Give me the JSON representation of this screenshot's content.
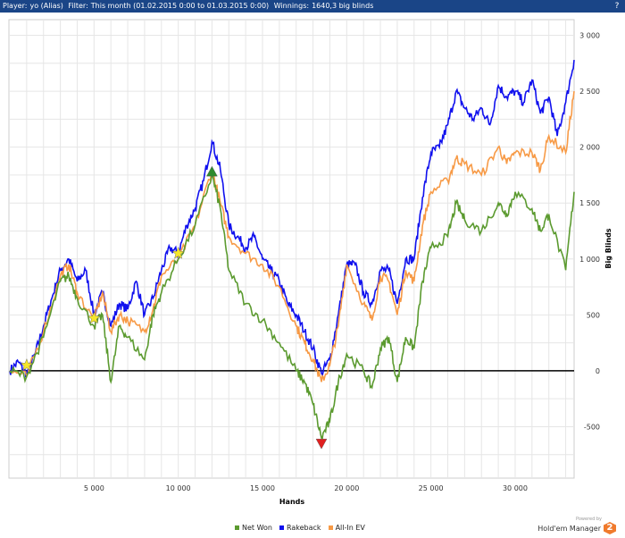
{
  "header": {
    "player_label": "Player:",
    "player": "yo (Alias)",
    "filter_label": "Filter:",
    "filter": "This month (01.02.2015 0:00 to 01.03.2015 0:00)",
    "winnings_label": "Winnings:",
    "winnings": "1640,3 big blinds",
    "help_icon": "?"
  },
  "branding": {
    "powered_by": "Powered by",
    "product": "Hold'em Manager",
    "logo_text": "2"
  },
  "chart_data": {
    "type": "line",
    "xlabel": "Hands",
    "ylabel": "Big Blinds",
    "xlim": [
      0,
      33500
    ],
    "ylim": [
      -960,
      3140
    ],
    "xticks": [
      5000,
      10000,
      15000,
      20000,
      25000,
      30000
    ],
    "xtick_labels": [
      "5 000",
      "10 000",
      "15 000",
      "20 000",
      "25 000",
      "30 000"
    ],
    "yticks": [
      -500,
      0,
      500,
      1000,
      1500,
      2000,
      2500,
      3000
    ],
    "ytick_labels": [
      "-500",
      "0",
      "500",
      "1 000",
      "1 500",
      "2 000",
      "2 500",
      "3 000"
    ],
    "grid": true,
    "legend_position": "bottom",
    "series": [
      {
        "name": "Net Won",
        "color": "#5b9a2f",
        "points": [
          [
            0,
            0
          ],
          [
            1000,
            -50
          ],
          [
            2000,
            300
          ],
          [
            3000,
            800
          ],
          [
            3500,
            850
          ],
          [
            4000,
            650
          ],
          [
            5000,
            400
          ],
          [
            5500,
            500
          ],
          [
            6000,
            -100
          ],
          [
            6500,
            400
          ],
          [
            7000,
            300
          ],
          [
            8000,
            100
          ],
          [
            8500,
            500
          ],
          [
            9000,
            700
          ],
          [
            10000,
            1000
          ],
          [
            11000,
            1300
          ],
          [
            12000,
            1750
          ],
          [
            12500,
            1450
          ],
          [
            13000,
            900
          ],
          [
            14000,
            600
          ],
          [
            15000,
            450
          ],
          [
            16000,
            250
          ],
          [
            17000,
            0
          ],
          [
            17500,
            -100
          ],
          [
            18000,
            -300
          ],
          [
            18500,
            -600
          ],
          [
            19000,
            -450
          ],
          [
            19500,
            -100
          ],
          [
            20000,
            150
          ],
          [
            21000,
            0
          ],
          [
            21500,
            -150
          ],
          [
            22000,
            200
          ],
          [
            22500,
            300
          ],
          [
            23000,
            -100
          ],
          [
            23500,
            300
          ],
          [
            24000,
            200
          ],
          [
            24500,
            800
          ],
          [
            25000,
            1100
          ],
          [
            26000,
            1200
          ],
          [
            26500,
            1500
          ],
          [
            27000,
            1350
          ],
          [
            28000,
            1250
          ],
          [
            29000,
            1500
          ],
          [
            29500,
            1400
          ],
          [
            30000,
            1600
          ],
          [
            31000,
            1450
          ],
          [
            31500,
            1250
          ],
          [
            32000,
            1400
          ],
          [
            33000,
            900
          ],
          [
            33500,
            1600
          ]
        ]
      },
      {
        "name": "Rakeback",
        "color": "#1010ee",
        "points": [
          [
            0,
            0
          ],
          [
            500,
            80
          ],
          [
            1000,
            -30
          ],
          [
            1500,
            150
          ],
          [
            2000,
            400
          ],
          [
            2500,
            650
          ],
          [
            3000,
            900
          ],
          [
            3500,
            1000
          ],
          [
            4000,
            800
          ],
          [
            4500,
            900
          ],
          [
            5000,
            500
          ],
          [
            5500,
            700
          ],
          [
            6000,
            400
          ],
          [
            6500,
            600
          ],
          [
            7000,
            550
          ],
          [
            7500,
            800
          ],
          [
            8000,
            500
          ],
          [
            8500,
            650
          ],
          [
            9000,
            900
          ],
          [
            9500,
            1100
          ],
          [
            10000,
            1050
          ],
          [
            10500,
            1300
          ],
          [
            11000,
            1450
          ],
          [
            11500,
            1700
          ],
          [
            12000,
            2050
          ],
          [
            12500,
            1800
          ],
          [
            13000,
            1300
          ],
          [
            13500,
            1200
          ],
          [
            14000,
            1100
          ],
          [
            14500,
            1200
          ],
          [
            15000,
            1000
          ],
          [
            15500,
            900
          ],
          [
            16000,
            800
          ],
          [
            16500,
            600
          ],
          [
            17000,
            500
          ],
          [
            17500,
            350
          ],
          [
            18000,
            200
          ],
          [
            18500,
            -20
          ],
          [
            19000,
            100
          ],
          [
            19500,
            500
          ],
          [
            20000,
            950
          ],
          [
            20500,
            950
          ],
          [
            21000,
            700
          ],
          [
            21500,
            600
          ],
          [
            22000,
            900
          ],
          [
            22500,
            900
          ],
          [
            23000,
            600
          ],
          [
            23500,
            1000
          ],
          [
            24000,
            1000
          ],
          [
            24500,
            1550
          ],
          [
            25000,
            1950
          ],
          [
            25500,
            2000
          ],
          [
            26000,
            2200
          ],
          [
            26500,
            2500
          ],
          [
            27000,
            2350
          ],
          [
            27500,
            2250
          ],
          [
            28000,
            2350
          ],
          [
            28500,
            2200
          ],
          [
            29000,
            2550
          ],
          [
            29500,
            2450
          ],
          [
            30000,
            2500
          ],
          [
            30500,
            2400
          ],
          [
            31000,
            2600
          ],
          [
            31500,
            2300
          ],
          [
            32000,
            2450
          ],
          [
            32500,
            2100
          ],
          [
            33000,
            2400
          ],
          [
            33500,
            2780
          ]
        ]
      },
      {
        "name": "All-In EV",
        "color": "#f79a46",
        "points": [
          [
            0,
            0
          ],
          [
            1000,
            -50
          ],
          [
            2000,
            350
          ],
          [
            3000,
            850
          ],
          [
            3500,
            950
          ],
          [
            4000,
            700
          ],
          [
            5000,
            450
          ],
          [
            5500,
            700
          ],
          [
            6000,
            350
          ],
          [
            6500,
            500
          ],
          [
            7000,
            450
          ],
          [
            8000,
            350
          ],
          [
            8500,
            550
          ],
          [
            9000,
            850
          ],
          [
            10000,
            1000
          ],
          [
            11000,
            1300
          ],
          [
            12000,
            1800
          ],
          [
            12500,
            1500
          ],
          [
            13000,
            1200
          ],
          [
            14000,
            1050
          ],
          [
            15000,
            950
          ],
          [
            16000,
            750
          ],
          [
            17000,
            400
          ],
          [
            17500,
            250
          ],
          [
            18000,
            100
          ],
          [
            18500,
            -100
          ],
          [
            19000,
            50
          ],
          [
            19500,
            400
          ],
          [
            20000,
            950
          ],
          [
            21000,
            600
          ],
          [
            21500,
            450
          ],
          [
            22000,
            850
          ],
          [
            22500,
            800
          ],
          [
            23000,
            500
          ],
          [
            23500,
            900
          ],
          [
            24000,
            800
          ],
          [
            24500,
            1300
          ],
          [
            25000,
            1600
          ],
          [
            26000,
            1700
          ],
          [
            26500,
            1900
          ],
          [
            27000,
            1850
          ],
          [
            28000,
            1750
          ],
          [
            29000,
            2000
          ],
          [
            29500,
            1850
          ],
          [
            30000,
            1950
          ],
          [
            31000,
            1950
          ],
          [
            31500,
            1800
          ],
          [
            32000,
            2100
          ],
          [
            33000,
            1950
          ],
          [
            33500,
            2500
          ]
        ]
      }
    ],
    "markers": [
      {
        "type": "star",
        "x": 1000,
        "y": 50,
        "color": "#f5e62a"
      },
      {
        "type": "star",
        "x": 5000,
        "y": 470,
        "color": "#f5e62a"
      },
      {
        "type": "star",
        "x": 10000,
        "y": 1050,
        "color": "#f5e62a"
      },
      {
        "type": "triangle-up",
        "x": 12000,
        "y": 1780,
        "color": "#2e8b2e"
      },
      {
        "type": "triangle-down",
        "x": 18500,
        "y": -650,
        "color": "#e02020"
      }
    ]
  }
}
